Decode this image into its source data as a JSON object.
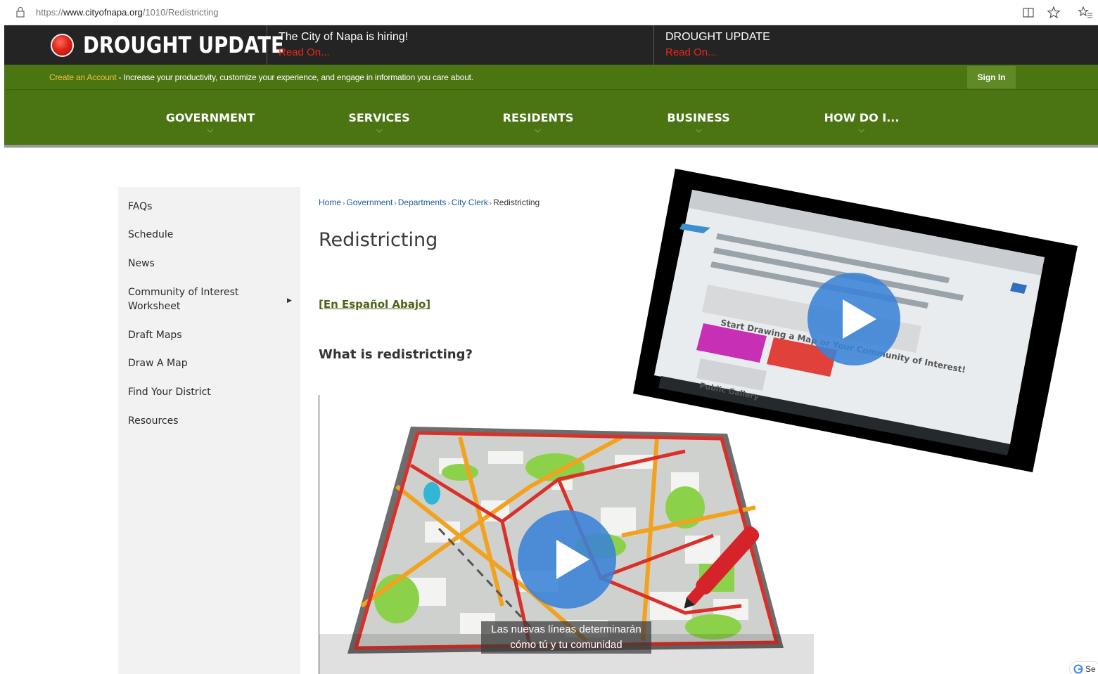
{
  "browser": {
    "url_prefix": "https://",
    "url_host": "www.cityofnapa.org",
    "url_path": "/1010/Redistricting"
  },
  "alerts": {
    "logo_text": "DROUGHT UPDATE",
    "items": [
      {
        "title": "The City of Napa is hiring!",
        "link": "Read On..."
      },
      {
        "title": "DROUGHT UPDATE",
        "link": "Read On..."
      }
    ]
  },
  "account_bar": {
    "create_link": "Create an Account",
    "message": " - Increase your productivity, customize your experience, and engage in information you care about.",
    "sign_in": "Sign In"
  },
  "main_nav": [
    "GOVERNMENT",
    "SERVICES",
    "RESIDENTS",
    "BUSINESS",
    "HOW DO I..."
  ],
  "side_nav": [
    "FAQs",
    "Schedule",
    "News",
    "Community of Interest Worksheet",
    "Draft Maps",
    "Draw A Map",
    "Find Your District",
    "Resources"
  ],
  "breadcrumb": [
    "Home",
    "Government",
    "Departments",
    "City Clerk",
    "Redistricting"
  ],
  "page": {
    "title": "Redistricting",
    "spanish_link": "[En Español Abajo]",
    "question": "What is redistricting?"
  },
  "video1_screen": {
    "button_1": "Start Drawing a Map or Your Community of Interest!",
    "button_2": "Public Gallery"
  },
  "video2": {
    "caption_line1": "Las nuevas líneas determinarán",
    "caption_line2": "cómo tú y tu comunidad"
  },
  "translate_widget": {
    "label": "Se"
  },
  "colors": {
    "alert_bar": "#242424",
    "brand_green": "#4a7512",
    "alert_red": "#e8281a",
    "create_link_yellow": "#f3c23a"
  }
}
